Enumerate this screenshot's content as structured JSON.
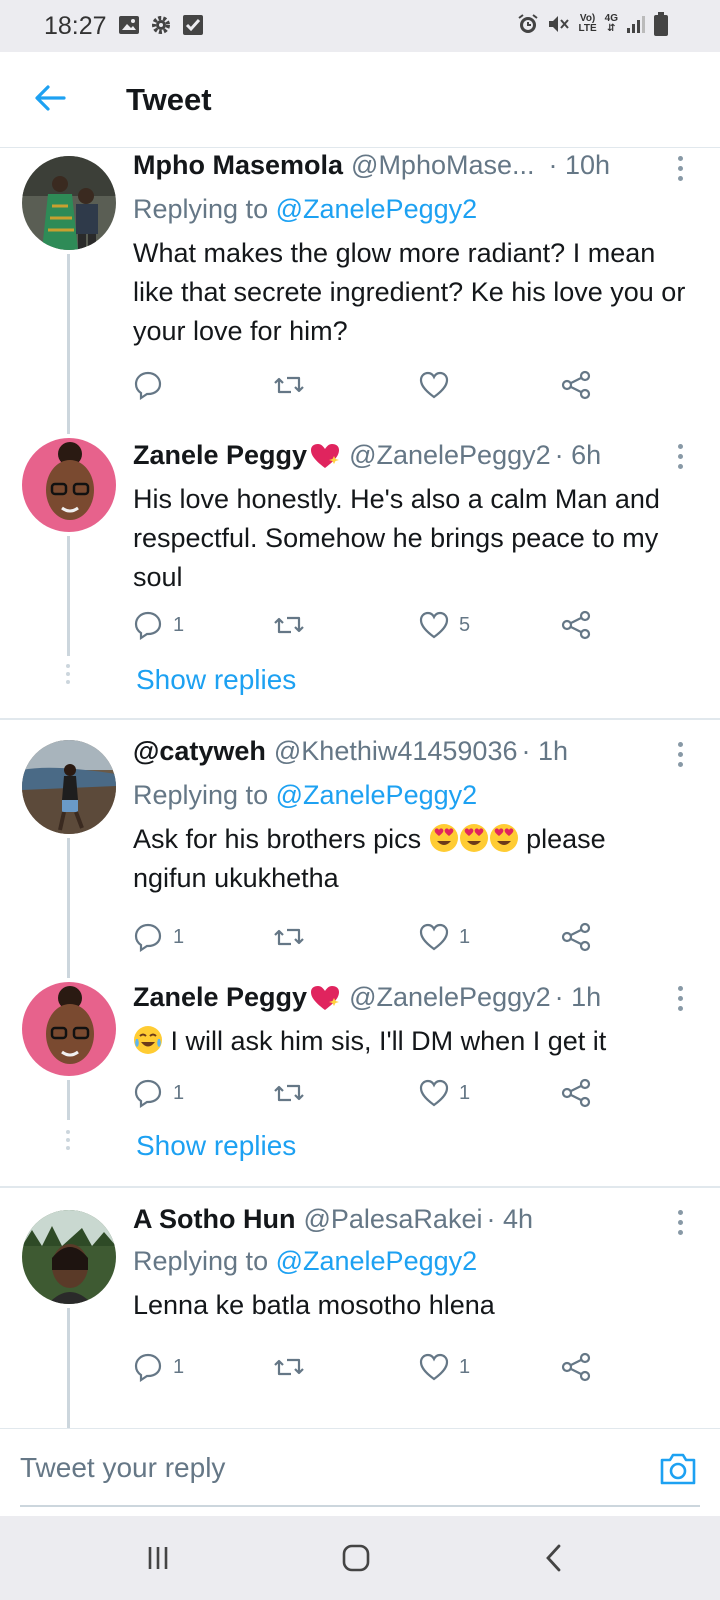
{
  "status_bar": {
    "time": "18:27",
    "icons": [
      "gallery-icon",
      "settings-icon",
      "check-icon",
      "alarm-icon",
      "mute-icon",
      "volte-icon",
      "4g-icon",
      "signal-icon",
      "battery-icon"
    ],
    "volte_top": "Vo)",
    "volte_bottom": "LTE",
    "net_label": "4G"
  },
  "header": {
    "title": "Tweet"
  },
  "tweets": [
    {
      "name": "Mpho Masemola",
      "handle": "@MphoMase...",
      "time": "· 10h",
      "replying_prefix": "Replying to ",
      "replying_to": "@ZanelePeggy2",
      "text": "What makes the glow more radiant? I mean like that secrete ingredient? Ke his love you or your love for him?",
      "replies": "",
      "likes": ""
    },
    {
      "name": "Zanele Peggy",
      "handle": "@ZanelePeggy2",
      "time": "· 6h",
      "text": "His love honestly. He's also a calm Man and respectful. Somehow he brings peace to my soul",
      "replies": "1",
      "likes": "5",
      "show_replies": "Show replies"
    },
    {
      "name": "@catyweh",
      "handle": "@Khethiw41459036",
      "time": "· 1h",
      "replying_prefix": "Replying to ",
      "replying_to": "@ZanelePeggy2",
      "text_before": "Ask for  his brothers pics ",
      "text_after": " please",
      "text_line2": "ngifun ukukhetha",
      "replies": "1",
      "likes": "1"
    },
    {
      "name": "Zanele Peggy",
      "handle": "@ZanelePeggy2",
      "time": "· 1h",
      "text": " I will ask him sis, I'll DM when I get it",
      "replies": "1",
      "likes": "1",
      "show_replies": "Show replies"
    },
    {
      "name": "A Sotho Hun",
      "handle": "@PalesaRakei",
      "time": "· 4h",
      "replying_prefix": "Replying to ",
      "replying_to": "@ZanelePeggy2",
      "text": "Lenna ke batla mosotho hlena",
      "replies": "1",
      "likes": "1"
    }
  ],
  "reply_bar": {
    "placeholder": "Tweet your reply"
  },
  "colors": {
    "accent": "#1da1f2",
    "secondary_text": "#657786",
    "divider": "#e1e8ed",
    "heart_emoji": "#e0245e"
  }
}
